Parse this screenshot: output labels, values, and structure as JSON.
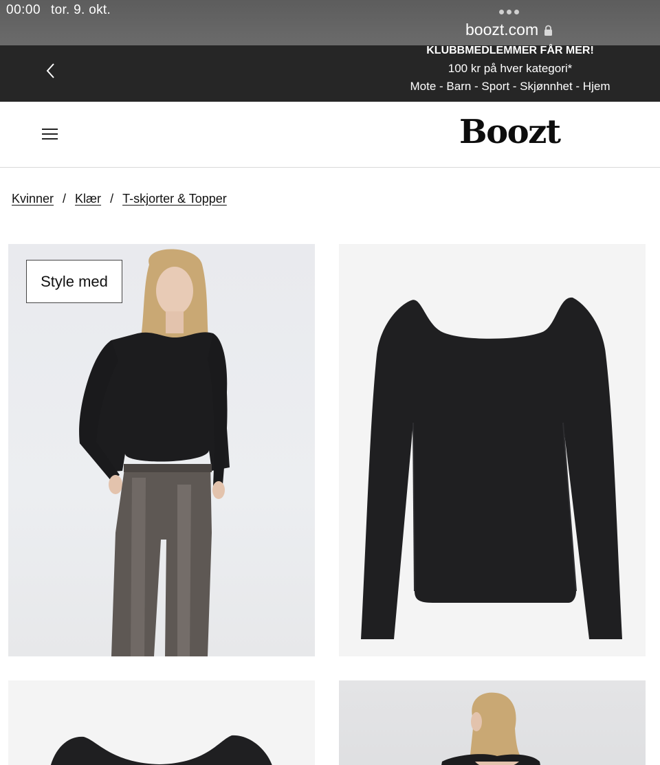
{
  "status_bar": {
    "time": "00:00",
    "date": "tor. 9. okt."
  },
  "browser": {
    "url": "boozt.com",
    "menu_icon": "more-dots-icon",
    "lock_icon": "lock-icon"
  },
  "promo": {
    "title": "KLUBBMEDLEMMER FÅR MER!",
    "line1": "100 kr på hver kategori*",
    "line2": "Mote - Barn - Sport - Skjønnhet - Hjem",
    "back_icon": "chevron-left-icon"
  },
  "header": {
    "logo": "Boozt",
    "menu_icon": "hamburger-icon"
  },
  "breadcrumb": {
    "items": [
      "Kvinner",
      "Klær",
      "T-skjorter & Topper"
    ],
    "separator": "/"
  },
  "gallery": {
    "style_button": "Style med",
    "colors": {
      "top": "#1c1c1e",
      "pants": "#5e5854",
      "background": "#f4f4f4"
    }
  }
}
